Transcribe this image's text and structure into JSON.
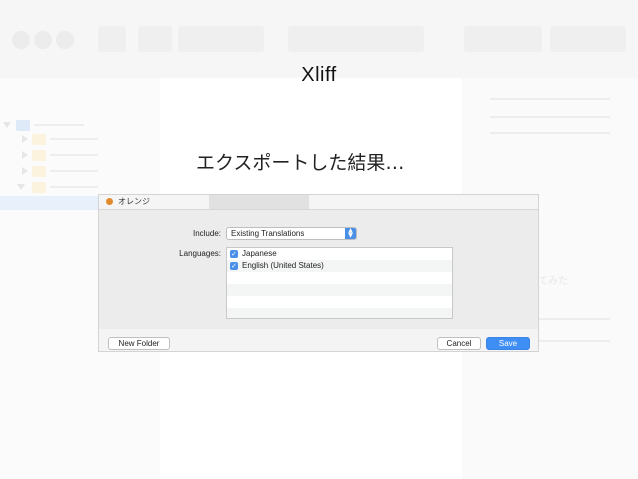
{
  "slide": {
    "title": "Xliff",
    "subtitle": "エクスポートした結果…"
  },
  "background_window": {
    "selected_item": "オレンジ",
    "faded_text": "てみた"
  },
  "dialog": {
    "include_label": "Include:",
    "include_value": "Existing Translations",
    "languages_label": "Languages:",
    "languages": [
      {
        "label": "Japanese",
        "checked": true
      },
      {
        "label": "English (United States)",
        "checked": true
      }
    ],
    "new_folder_label": "New Folder",
    "cancel_label": "Cancel",
    "save_label": "Save"
  },
  "colors": {
    "accent": "#3f8ef5",
    "orange": "#e38b2c"
  }
}
